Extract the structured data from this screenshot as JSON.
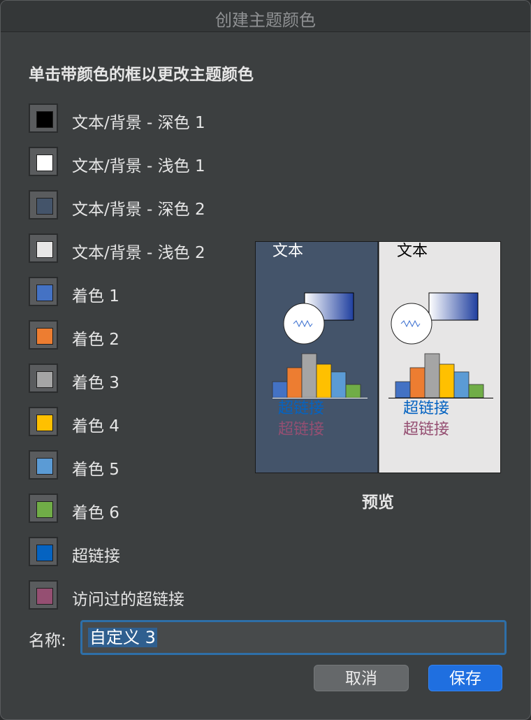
{
  "window": {
    "title": "创建主题颜色"
  },
  "instruction": "单击带颜色的框以更改主题颜色",
  "colors": [
    {
      "label": "文本/背景 - 深色 1",
      "color": "#000000"
    },
    {
      "label": "文本/背景 - 浅色 1",
      "color": "#ffffff"
    },
    {
      "label": "文本/背景 - 深色 2",
      "color": "#44546a"
    },
    {
      "label": "文本/背景 - 浅色 2",
      "color": "#e7e6e6"
    },
    {
      "label": "着色 1",
      "color": "#4472c4"
    },
    {
      "label": "着色 2",
      "color": "#ed7d31"
    },
    {
      "label": "着色 3",
      "color": "#a5a5a5"
    },
    {
      "label": "着色 4",
      "color": "#ffc000"
    },
    {
      "label": "着色 5",
      "color": "#5b9bd5"
    },
    {
      "label": "着色 6",
      "color": "#70ad47"
    },
    {
      "label": "超链接",
      "color": "#0563c1"
    },
    {
      "label": "访问过的超链接",
      "color": "#954f72"
    }
  ],
  "preview": {
    "label": "预览",
    "panels": [
      {
        "name": "dark",
        "background": "#44546a",
        "text_color": "#ffffff",
        "text": "文本",
        "hyperlink": "超链接",
        "visited_hyperlink": "超链接"
      },
      {
        "name": "light",
        "background": "#e7e6e6",
        "text_color": "#000000",
        "text": "文本",
        "hyperlink": "超链接",
        "visited_hyperlink": "超链接"
      }
    ],
    "bar_levels": [
      0.36,
      0.68,
      1.0,
      0.76,
      0.58,
      0.3
    ]
  },
  "name_field": {
    "label": "名称:",
    "value": "自定义 3"
  },
  "buttons": {
    "cancel": "取消",
    "save": "保存"
  }
}
